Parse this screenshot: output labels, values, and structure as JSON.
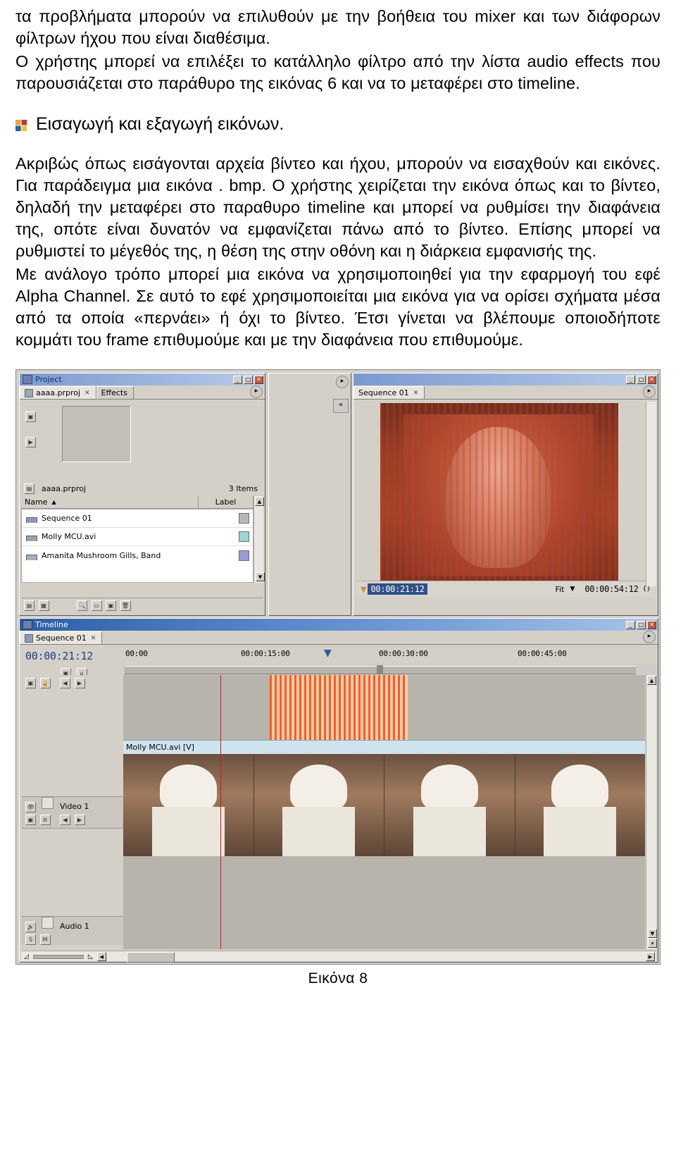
{
  "document": {
    "paragraphs": [
      "τα προβλήματα μπορούν να επιλυθούν με την βοήθεια του mixer και των διάφορων φίλτρων ήχου που είναι διαθέσιμα.",
      "Ο χρήστης μπορεί να επιλέξει το κατάλληλο φίλτρο από την λίστα audio effects που παρουσιάζεται στο παράθυρο της εικόνας 6 και να το μεταφέρει στο timeline."
    ],
    "heading": "Εισαγωγή και εξαγωγή εικόνων.",
    "body_paragraphs": [
      "Ακριβώς όπως εισάγονται αρχεία βίντεο και ήχου, μπορούν να εισαχθούν και εικόνες. Για παράδειγμα μια εικόνα . bmp.  Ο χρήστης χειρίζεται την εικόνα όπως και το βίντεο, δηλαδή την μεταφέρει στο παραθυρο timeline και μπορεί να ρυθμίσει την διαφάνεια της, οπότε είναι δυνατόν να εμφανίζεται πάνω από το βίντεο.  Επίσης μπορεί να ρυθμιστεί το μέγεθός της, η θέση της στην οθόνη και η διάρκεια εμφανισής της.",
      "Με ανάλογο τρόπο μπορεί μια εικόνα να χρησιμοποιηθεί για την εφαρμογή του εφέ Alpha Channel.  Σε αυτό το εφέ χρησιμοποιείται μια εικόνα για να ορίσει σχήματα μέσα από τα οποία «περνάει» ή όχι το βίντεο.  Έτσι γίνεται να βλέπουμε οποιοδήποτε κομμάτι του frame επιθυμούμε και με την διαφάνεια που επιθυμούμε."
    ],
    "figure_caption": "Εικόνα 8"
  },
  "screenshot": {
    "project_window": {
      "title": "Project",
      "tabs": [
        {
          "label": "aaaa.prproj",
          "close": "✕",
          "active": true
        },
        {
          "label": "Effects",
          "close": "",
          "active": false
        }
      ],
      "bin_name": "aaaa.prproj",
      "item_count": "3 Items",
      "columns": [
        "Name",
        "Label"
      ],
      "sort_indicator": "▲",
      "items": [
        {
          "name": "Sequence 01",
          "icon": "sequence-icon",
          "label_color": "#b8b8b8"
        },
        {
          "name": "Molly MCU.avi",
          "icon": "video-clip-icon",
          "label_color": "#9fd3cf"
        },
        {
          "name": "Amanita Mushroom Gills, Band",
          "icon": "audio-clip-icon",
          "label_color": "#9a9ad6"
        }
      ],
      "window_buttons": [
        "_",
        "□",
        "✕"
      ]
    },
    "monitor_window": {
      "title": "Sequence 01",
      "tab_close": "✕",
      "current_time": "00:00:21:12",
      "fit_label": "Fit",
      "duration": "00:00:54:12",
      "window_buttons": [
        "_",
        "□",
        "✕"
      ]
    },
    "timeline_window": {
      "title": "Timeline",
      "tab_label": "Sequence 01",
      "tab_close": "✕",
      "timecode": "00:00:21:12",
      "ruler_labels": [
        "00:00",
        "00:00:15:00",
        "00:00:30:00",
        "00:00:45:00"
      ],
      "clip_label": "Molly MCU.avi [V]",
      "tracks": [
        {
          "name": "Video 1"
        },
        {
          "name": "Audio 1"
        }
      ],
      "window_buttons": [
        "_",
        "□",
        "✕"
      ]
    }
  }
}
